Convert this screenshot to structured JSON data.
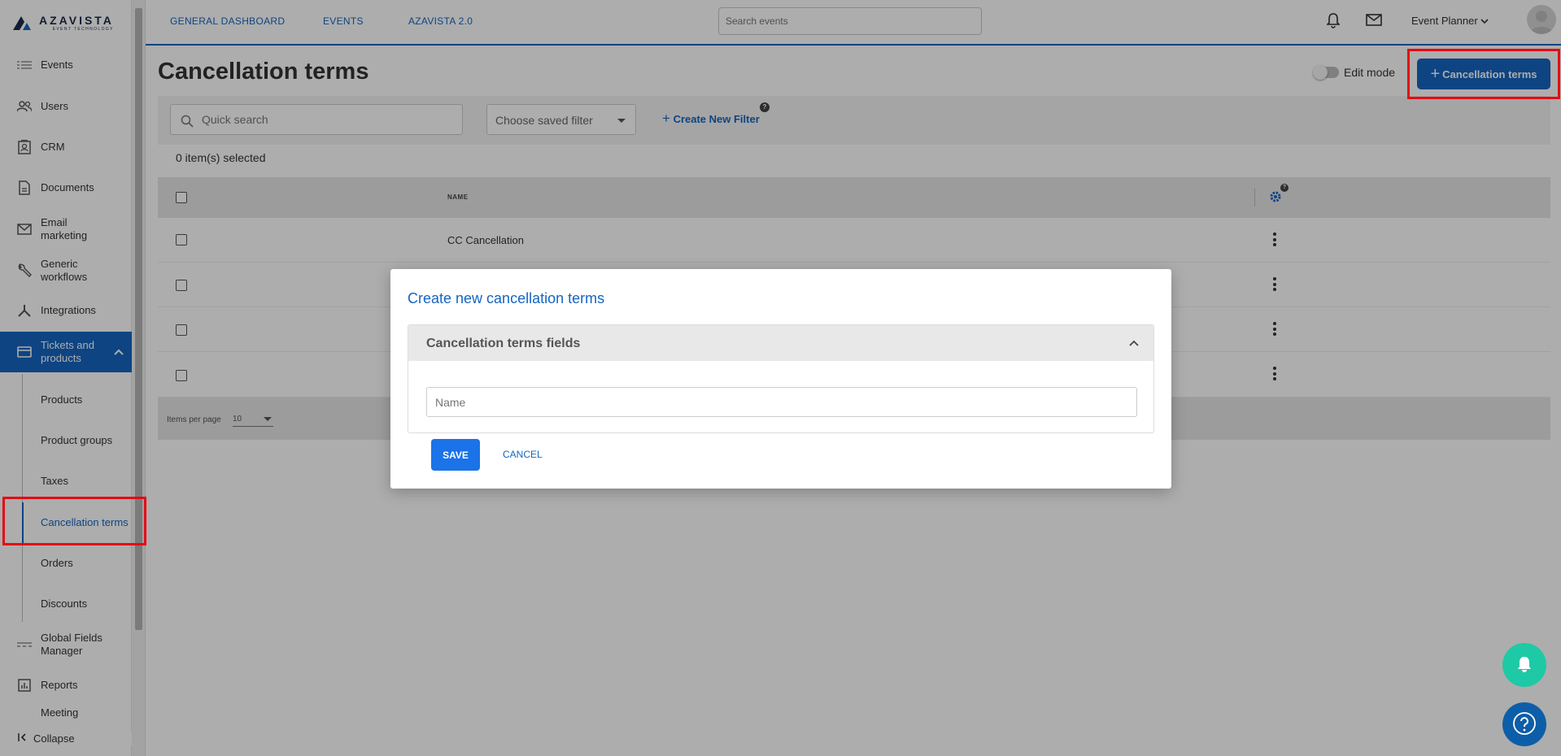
{
  "logo": {
    "word": "AZAVISTA",
    "sub": "EVENT TECHNOLOGY"
  },
  "sidebar": {
    "items": [
      {
        "label": "Events",
        "icon": "list-icon"
      },
      {
        "label": "Users",
        "icon": "users-icon"
      },
      {
        "label": "CRM",
        "icon": "contact-card-icon"
      },
      {
        "label": "Documents",
        "icon": "document-icon"
      },
      {
        "label": "Email marketing",
        "icon": "mail-icon"
      },
      {
        "label": "Generic workflows",
        "icon": "wrench-icon"
      },
      {
        "label": "Integrations",
        "icon": "integrations-icon"
      },
      {
        "label": "Tickets and products",
        "icon": "card-icon"
      },
      {
        "label": "Global Fields Manager",
        "icon": "fields-icon"
      },
      {
        "label": "Reports",
        "icon": "chart-icon"
      },
      {
        "label": "Meeting",
        "icon": ""
      }
    ],
    "subitems": [
      "Products",
      "Product groups",
      "Taxes",
      "Cancellation terms",
      "Orders",
      "Discounts"
    ],
    "collapse_label": "Collapse"
  },
  "topbar": {
    "links": [
      "GENERAL DASHBOARD",
      "EVENTS",
      "AZAVISTA 2.0"
    ],
    "search_placeholder": "Search events",
    "user_name": "Event Planner"
  },
  "main": {
    "title": "Cancellation terms",
    "edit_mode_label": "Edit mode",
    "add_button_label": "Cancellation terms",
    "quick_search_placeholder": "Quick search",
    "saved_filter_label": "Choose saved filter",
    "create_filter_label": "Create New Filter",
    "selected_count": "0 item(s) selected",
    "table": {
      "column_name": "NAME",
      "rows": [
        "CC Cancellation",
        "",
        "",
        ""
      ]
    },
    "items_per_page_label": "Items per page",
    "items_per_page_value": "10"
  },
  "modal": {
    "title": "Create new cancellation terms",
    "panel_title": "Cancellation terms fields",
    "name_placeholder": "Name",
    "save_label": "SAVE",
    "cancel_label": "CANCEL"
  },
  "colors": {
    "accent": "#1565c0",
    "highlight": "#e50914",
    "bell_fab": "#1ec9a6"
  }
}
